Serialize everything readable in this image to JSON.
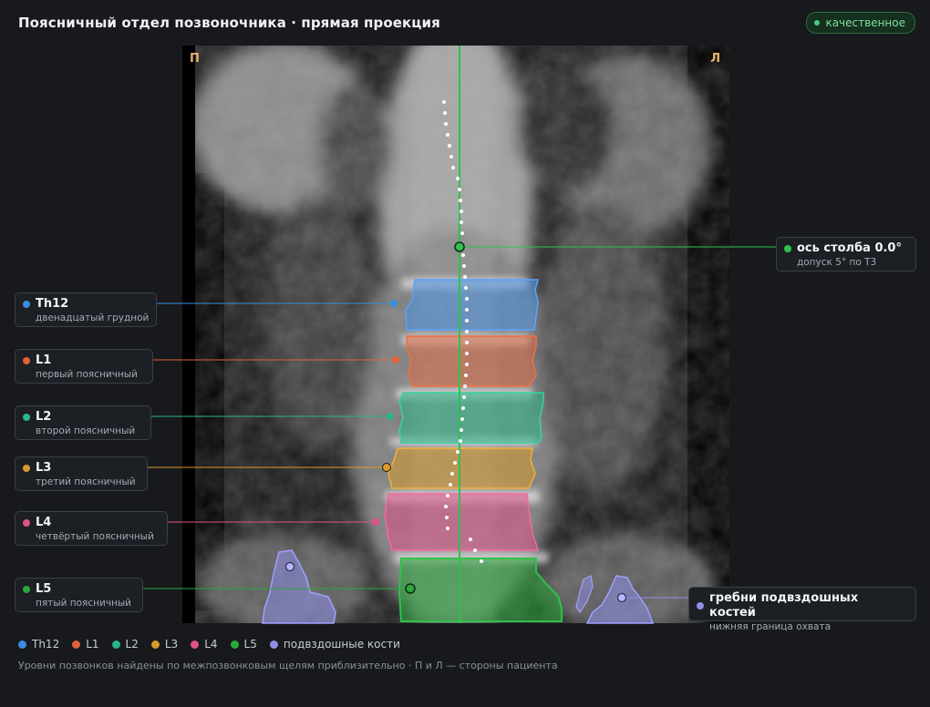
{
  "header": {
    "title": "Поясничный отдел позвоночника · прямая проекция"
  },
  "status": {
    "label": "качественное",
    "color": "#47d17d"
  },
  "viewer": {
    "left_marker": "П",
    "right_marker": "Л"
  },
  "vertebrae": [
    {
      "name": "Th12",
      "description": "двенадцатый грудной",
      "color": "#3b8de0"
    },
    {
      "name": "L1",
      "description": "первый поясничный",
      "color": "#e0623a"
    },
    {
      "name": "L2",
      "description": "второй поясничный",
      "color": "#2bb58a"
    },
    {
      "name": "L3",
      "description": "третий поясничный",
      "color": "#d99a2b"
    },
    {
      "name": "L4",
      "description": "четвёртый поясничный",
      "color": "#e0528a"
    },
    {
      "name": "L5",
      "description": "пятый поясничный",
      "color": "#2aa83c"
    }
  ],
  "axis": {
    "label": "ось столба 0.0°",
    "sub": "допуск 5° по Т3",
    "color": "#2fc24a"
  },
  "iliac": {
    "label": "гребни подвздошных костей",
    "sub": "нижняя граница охвата",
    "color": "#8e8ee6"
  },
  "legend": [
    {
      "label": "Th12",
      "color": "#3b8de0"
    },
    {
      "label": "L1",
      "color": "#e0623a"
    },
    {
      "label": "L2",
      "color": "#2bb58a"
    },
    {
      "label": "L3",
      "color": "#d99a2b"
    },
    {
      "label": "L4",
      "color": "#e0528a"
    },
    {
      "label": "L5",
      "color": "#2aa83c"
    },
    {
      "label": "подвздошные кости",
      "color": "#8e8ee6"
    }
  ],
  "footnote": "Уровни позвонков найдены по межпозвонковым щелям приблизительно · П и Л — стороны пациента"
}
